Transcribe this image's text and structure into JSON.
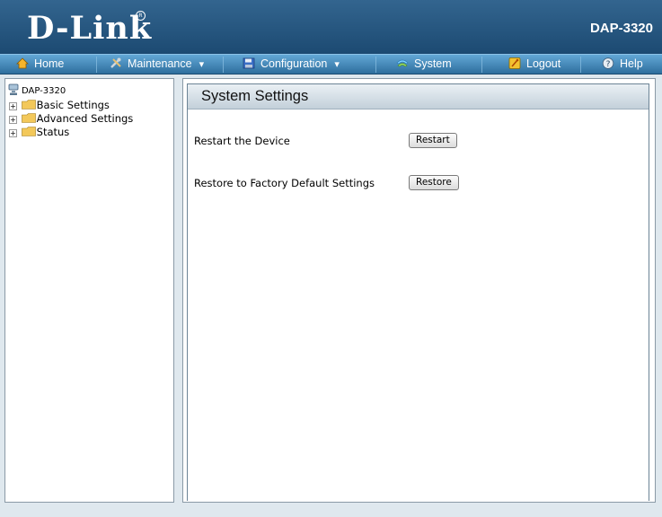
{
  "header": {
    "logo_text": "D-Link",
    "model": "DAP-3320"
  },
  "nav": {
    "items": [
      {
        "label": "Home",
        "icon": "home-icon"
      },
      {
        "label": "Maintenance",
        "icon": "tools-icon",
        "has_dropdown": true
      },
      {
        "label": "Configuration",
        "icon": "save-disk-icon",
        "has_dropdown": true
      },
      {
        "label": "System",
        "icon": "system-icon"
      },
      {
        "label": "Logout",
        "icon": "logout-icon"
      },
      {
        "label": "Help",
        "icon": "help-icon"
      }
    ],
    "dropdown_glyph": "▾"
  },
  "sidebar": {
    "root_label": "DAP-3320",
    "items": [
      {
        "label": "Basic Settings"
      },
      {
        "label": "Advanced Settings"
      },
      {
        "label": "Status"
      }
    ],
    "expander_glyph": "+"
  },
  "main": {
    "title": "System Settings",
    "rows": [
      {
        "label": "Restart the Device",
        "button": "Restart"
      },
      {
        "label": "Restore to Factory Default Settings",
        "button": "Restore"
      }
    ]
  },
  "colors": {
    "header_top": "#33658f",
    "header_bottom": "#1c4a72",
    "nav_top": "#62a7d6",
    "nav_bottom": "#2e6e9d",
    "page_bg": "#dfe8ee"
  }
}
